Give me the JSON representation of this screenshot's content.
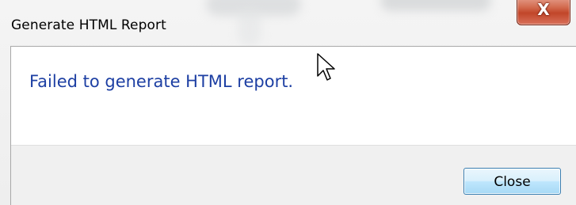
{
  "dialog": {
    "title": "Generate HTML Report",
    "close_glyph": "X",
    "message": "Failed to generate HTML report.",
    "close_button_label": "Close"
  },
  "colors": {
    "message_text": "#1d3fa3",
    "close_button_border": "#3c7fb1",
    "title_close_red": "#c1462a"
  },
  "icons": {
    "title_close": "close-icon",
    "pointer": "mouse-pointer-icon"
  }
}
